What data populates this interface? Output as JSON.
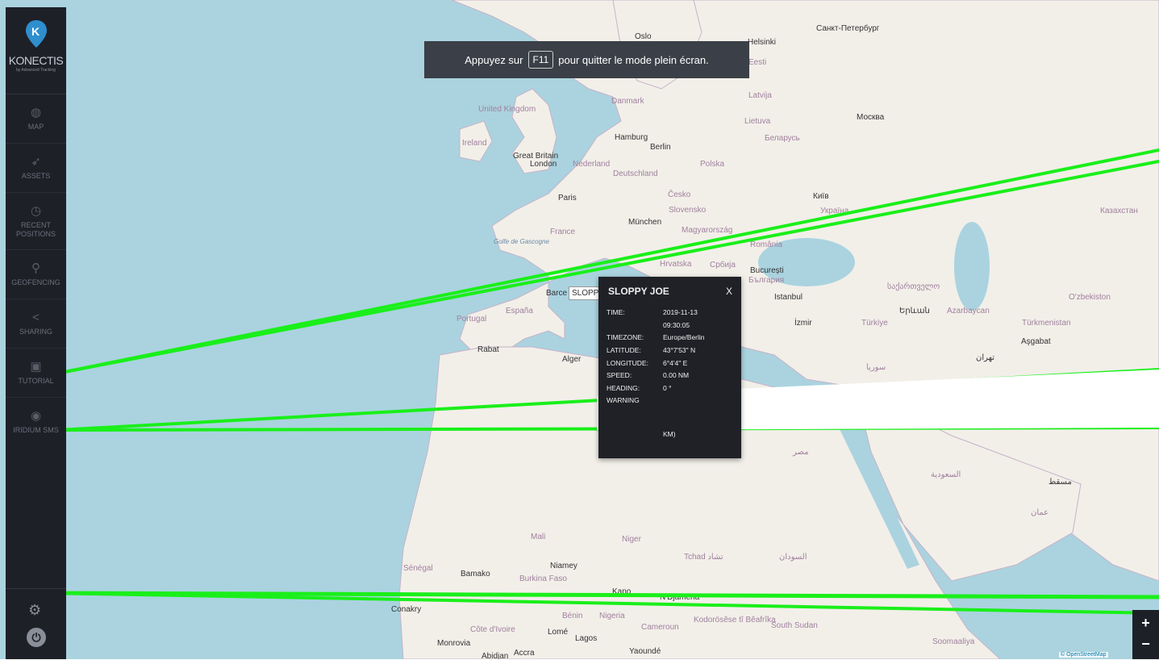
{
  "brand": {
    "name": "KONECTIS",
    "tagline": "by Advanced Tracking",
    "accent": "#2e8ece"
  },
  "banner": {
    "pre": "Appuyez sur",
    "key": "F11",
    "post": "pour quitter le mode plein écran."
  },
  "sidebar": {
    "items": [
      {
        "label": "MAP",
        "icon": "globe-icon"
      },
      {
        "label": "ASSETS",
        "icon": "rocket-icon"
      },
      {
        "label": "RECENT\nPOSITIONS",
        "icon": "clock-icon"
      },
      {
        "label": "GEOFENCING",
        "icon": "pin-icon"
      },
      {
        "label": "SHARING",
        "icon": "share-icon"
      },
      {
        "label": "TUTORIAL",
        "icon": "chat-icon"
      },
      {
        "label": "IRIDIUM SMS",
        "icon": "satellite-icon"
      }
    ],
    "settings_icon": "gear-icon",
    "logout_icon": "power-icon"
  },
  "marker": {
    "label": "SLOPP"
  },
  "popup": {
    "title": "SLOPPY JOE",
    "close": "X",
    "rows": [
      {
        "label": "TIME:",
        "value": "2019-11-13"
      },
      {
        "label": "",
        "value": "09:30:05"
      },
      {
        "label": "TIMEZONE:",
        "value": "Europe/Berlin"
      },
      {
        "label": "LATITUDE:",
        "value": "43°7'53\" N"
      },
      {
        "label": "LONGITUDE:",
        "value": "6°4'4\" E"
      },
      {
        "label": "SPEED:",
        "value": "0.00 NM"
      },
      {
        "label": "HEADING:",
        "value": "0 °"
      },
      {
        "label": "WARNING",
        "value": ""
      },
      {
        "label": "",
        "value": "KM)"
      }
    ]
  },
  "map_labels": [
    {
      "text": "Oslo",
      "type": "city"
    },
    {
      "text": "Helsinki",
      "type": "city"
    },
    {
      "text": "Санкт-Петербург",
      "type": "city"
    },
    {
      "text": "Eesti",
      "type": "country"
    },
    {
      "text": "Latvija",
      "type": "country"
    },
    {
      "text": "Lietuva",
      "type": "country"
    },
    {
      "text": "Москва",
      "type": "city"
    },
    {
      "text": "Danmark",
      "type": "country"
    },
    {
      "text": "United Kingdom",
      "type": "country"
    },
    {
      "text": "Ireland",
      "type": "country"
    },
    {
      "text": "Great Britain",
      "type": "city"
    },
    {
      "text": "London",
      "type": "city"
    },
    {
      "text": "Hamburg",
      "type": "city"
    },
    {
      "text": "Berlin",
      "type": "city"
    },
    {
      "text": "Nederland",
      "type": "country"
    },
    {
      "text": "Deutschland",
      "type": "country"
    },
    {
      "text": "Polska",
      "type": "country"
    },
    {
      "text": "Беларусь",
      "type": "country"
    },
    {
      "text": "Paris",
      "type": "city"
    },
    {
      "text": "Česko",
      "type": "country"
    },
    {
      "text": "Київ",
      "type": "city"
    },
    {
      "text": "Slovensko",
      "type": "country"
    },
    {
      "text": "Україна",
      "type": "country"
    },
    {
      "text": "Казахстан",
      "type": "country"
    },
    {
      "text": "France",
      "type": "country"
    },
    {
      "text": "München",
      "type": "city"
    },
    {
      "text": "Magyarország",
      "type": "country"
    },
    {
      "text": "România",
      "type": "country"
    },
    {
      "text": "Golfe de Gascogne",
      "type": "sea"
    },
    {
      "text": "Hrvatska",
      "type": "country"
    },
    {
      "text": "Србија",
      "type": "country"
    },
    {
      "text": "București",
      "type": "city"
    },
    {
      "text": "България",
      "type": "country"
    },
    {
      "text": "Barce",
      "type": "city"
    },
    {
      "text": "Istanbul",
      "type": "city"
    },
    {
      "text": "საქართველო",
      "type": "country"
    },
    {
      "text": "O'zbekiston",
      "type": "country"
    },
    {
      "text": "Portugal",
      "type": "country"
    },
    {
      "text": "España",
      "type": "country"
    },
    {
      "text": "Երևան",
      "type": "city"
    },
    {
      "text": "Azarbaycan",
      "type": "country"
    },
    {
      "text": "İzmir",
      "type": "city"
    },
    {
      "text": "Türkiye",
      "type": "country"
    },
    {
      "text": "Türkmenistan",
      "type": "country"
    },
    {
      "text": "Aşgabat",
      "type": "city"
    },
    {
      "text": "Rabat",
      "type": "city"
    },
    {
      "text": "Alger",
      "type": "city"
    },
    {
      "text": "تهران",
      "type": "city"
    },
    {
      "text": "سوريا",
      "type": "country"
    },
    {
      "text": "Mali",
      "type": "country"
    },
    {
      "text": "Niger",
      "type": "country"
    },
    {
      "text": "Tchad تشاد",
      "type": "country"
    },
    {
      "text": "السودان",
      "type": "country"
    },
    {
      "text": "Sénégal",
      "type": "country"
    },
    {
      "text": "Bamako",
      "type": "city"
    },
    {
      "text": "Niamey",
      "type": "city"
    },
    {
      "text": "Burkina Faso",
      "type": "country"
    },
    {
      "text": "Kano",
      "type": "city"
    },
    {
      "text": "N'Djaména",
      "type": "city"
    },
    {
      "text": "Conakry",
      "type": "city"
    },
    {
      "text": "Bénin",
      "type": "country"
    },
    {
      "text": "Nigeria",
      "type": "country"
    },
    {
      "text": "Kodorösêse tî Bêafrîka",
      "type": "country"
    },
    {
      "text": "South Sudan",
      "type": "country"
    },
    {
      "text": "Côte d'Ivoire",
      "type": "country"
    },
    {
      "text": "Lomé",
      "type": "city"
    },
    {
      "text": "Lagos",
      "type": "city"
    },
    {
      "text": "Cameroun",
      "type": "country"
    },
    {
      "text": "Monrovia",
      "type": "city"
    },
    {
      "text": "Abidjan",
      "type": "city"
    },
    {
      "text": "Accra",
      "type": "city"
    },
    {
      "text": "Yaoundé",
      "type": "city"
    },
    {
      "text": "Soomaaliya",
      "type": "country"
    },
    {
      "text": "مصر",
      "type": "country"
    },
    {
      "text": "السعودية",
      "type": "country"
    },
    {
      "text": "مسقط",
      "type": "city"
    },
    {
      "text": "عمان",
      "type": "country"
    }
  ],
  "zoom": {
    "plus": "+",
    "minus": "−"
  },
  "attribution": "© OpenStreetMap"
}
